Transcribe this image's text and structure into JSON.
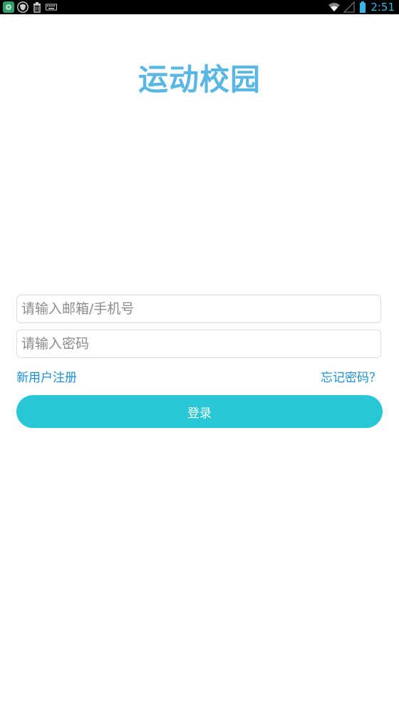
{
  "status_bar": {
    "time": "2:51",
    "left_icons": [
      "app-notification-icon",
      "shield-icon",
      "trash-icon",
      "keyboard-icon"
    ],
    "right_icons": [
      "wifi-icon",
      "signal-icon",
      "battery-icon"
    ],
    "accent_color": "#33b5e5"
  },
  "app": {
    "title": "运动校园",
    "title_color": "#5ab6e3"
  },
  "form": {
    "account_placeholder": "请输入邮箱/手机号",
    "account_value": "",
    "password_placeholder": "请输入密码",
    "password_value": "",
    "register_link": "新用户注册",
    "forgot_link": "忘记密码？",
    "login_label": "登录",
    "link_color": "#1e8fd4",
    "button_color": "#29c6d6"
  }
}
